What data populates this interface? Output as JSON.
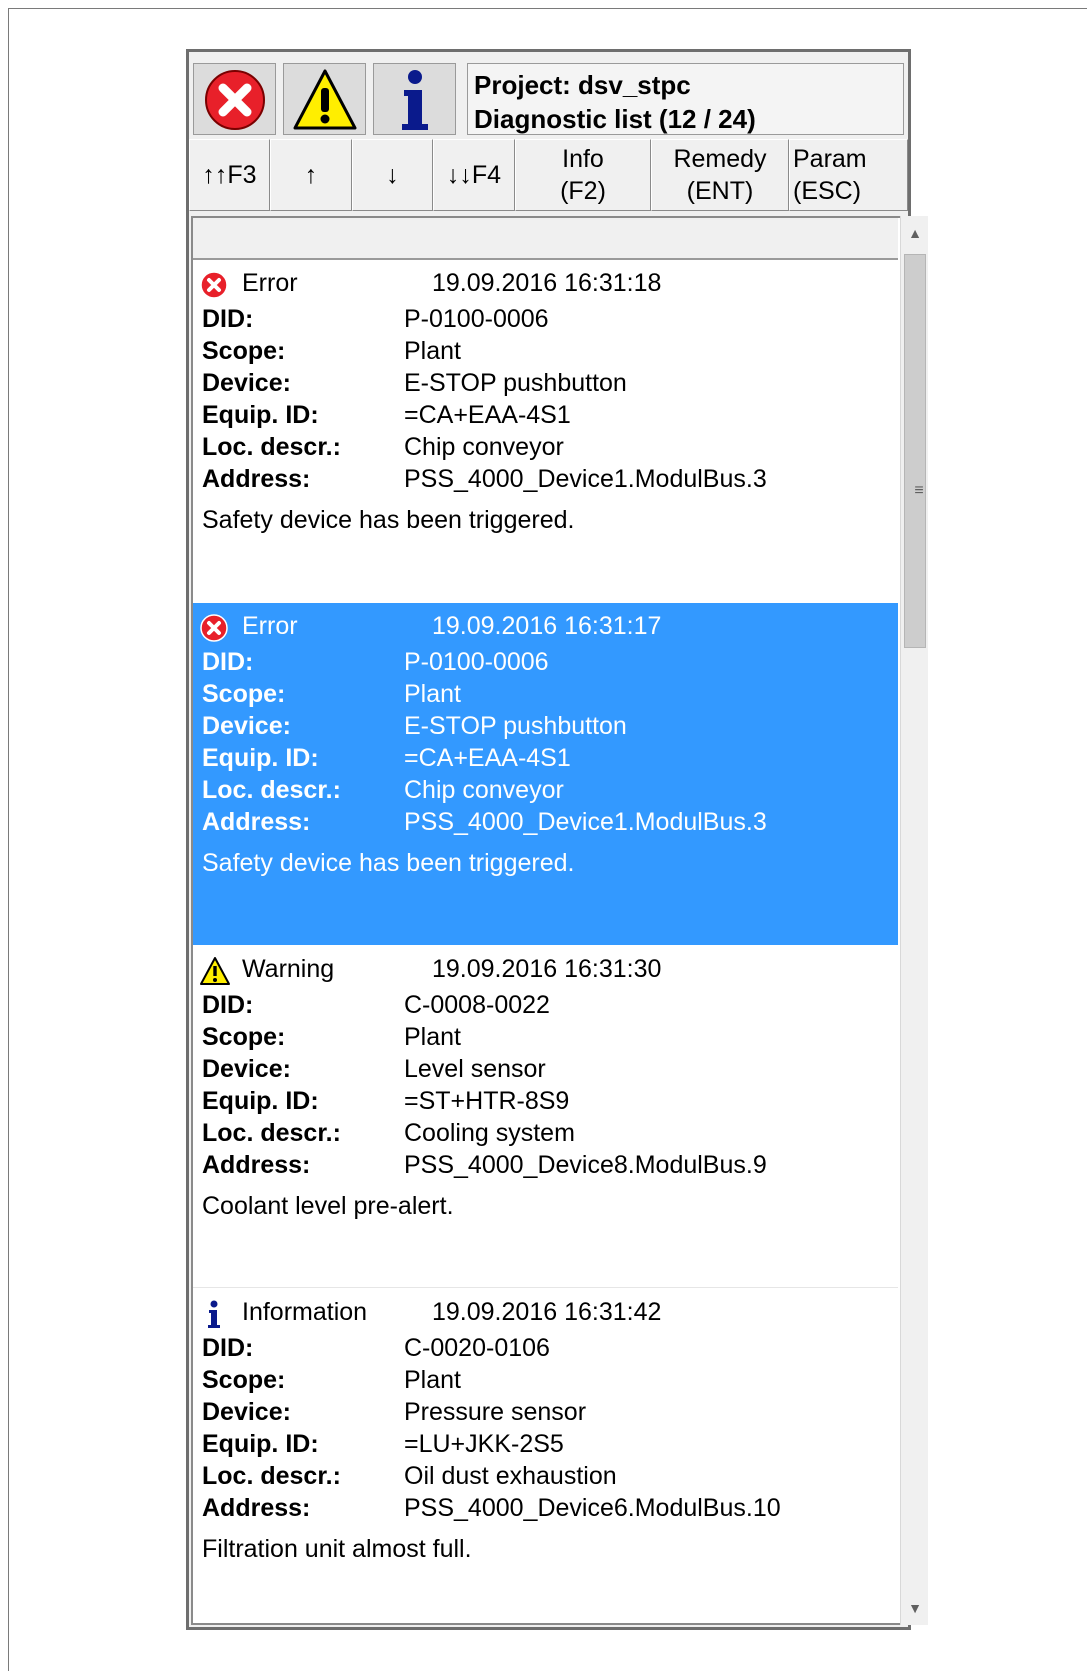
{
  "header": {
    "project_line": "Project: dsv_stpc",
    "list_line": "Diagnostic list (12 / 24)",
    "icons": [
      "error-filter-icon",
      "warning-filter-icon",
      "info-filter-icon"
    ]
  },
  "toolbar": {
    "first": {
      "glyph": "↑↑",
      "key": "F3"
    },
    "up": "↑",
    "down": "↓",
    "last": {
      "glyph": "↓↓",
      "key": "F4"
    },
    "info": {
      "l1": "Info",
      "l2": "(F2)"
    },
    "remedy": {
      "l1": "Remedy",
      "l2": "(ENT)"
    },
    "param": {
      "l1": "Param",
      "l2": "(ESC)"
    }
  },
  "labels": {
    "did": "DID:",
    "scope": "Scope:",
    "device": "Device:",
    "equip": "Equip. ID:",
    "loc": "Loc. descr.:",
    "address": "Address:"
  },
  "entries": [
    {
      "type": "Error",
      "icon": "error-icon",
      "time": "19.09.2016 16:31:18",
      "did": "P-0100-0006",
      "scope": "Plant",
      "device": "E-STOP pushbutton",
      "equip": "=CA+EAA-4S1",
      "loc": "Chip conveyor",
      "address": "PSS_4000_Device1.ModulBus.3",
      "message": "Safety device has been triggered.",
      "selected": false
    },
    {
      "type": "Error",
      "icon": "error-icon",
      "time": "19.09.2016 16:31:17",
      "did": "P-0100-0006",
      "scope": "Plant",
      "device": "E-STOP pushbutton",
      "equip": "=CA+EAA-4S1",
      "loc": "Chip conveyor",
      "address": "PSS_4000_Device1.ModulBus.3",
      "message": "Safety device has been triggered.",
      "selected": true
    },
    {
      "type": "Warning",
      "icon": "warning-icon",
      "time": "19.09.2016 16:31:30",
      "did": "C-0008-0022",
      "scope": "Plant",
      "device": "Level sensor",
      "equip": "=ST+HTR-8S9",
      "loc": "Cooling system",
      "address": "PSS_4000_Device8.ModulBus.9",
      "message": "Coolant level pre-alert.",
      "selected": false
    },
    {
      "type": "Information",
      "icon": "info-icon",
      "time": "19.09.2016 16:31:42",
      "did": "C-0020-0106",
      "scope": "Plant",
      "device": "Pressure sensor",
      "equip": "=LU+JKK-2S5",
      "loc": "Oil dust exhaustion",
      "address": "PSS_4000_Device6.ModulBus.10",
      "message": "Filtration unit almost full.",
      "selected": false
    }
  ],
  "colors": {
    "selection": "#3399ff",
    "error": "#e8202a",
    "warning": "#ffee00",
    "info": "#0a1a8c"
  }
}
